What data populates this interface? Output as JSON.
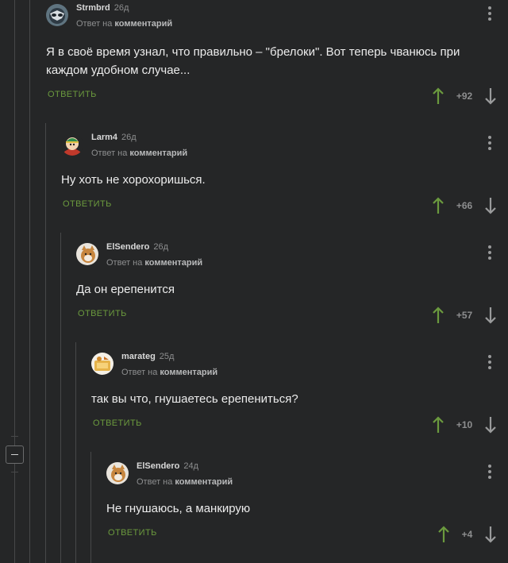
{
  "reply_to_prefix": "Ответ на",
  "reply_to_target": "комментарий",
  "reply_label": "ответить",
  "colors": {
    "upvote": "#6b9a3e",
    "downvote": "#9a9b9c",
    "reply": "#6b9a3e",
    "background": "#252627"
  },
  "comments": [
    {
      "author": "Strmbrd",
      "age": "26д",
      "text": "Я в своё время узнал, что правильно – \"брелоки\". Вот теперь чванюсь при каждом удобном случае...",
      "score": "+92",
      "avatar_icon": "raccoon-avatar-icon"
    },
    {
      "author": "Larm4",
      "age": "26д",
      "text": "Ну хоть не хорохоришься.",
      "score": "+66",
      "avatar_icon": "cartoon-avatar-icon"
    },
    {
      "author": "ElSendero",
      "age": "26д",
      "text": "Да он ерепенится",
      "score": "+57",
      "avatar_icon": "cat-avatar-icon"
    },
    {
      "author": "marateg",
      "age": "25д",
      "text": "так вы что, гнушаетесь ерепениться?",
      "score": "+10",
      "avatar_icon": "photo-avatar-icon"
    },
    {
      "author": "ElSendero",
      "age": "24д",
      "text": "Не гнушаюсь, а манкирую",
      "score": "+4",
      "avatar_icon": "cat-avatar-icon"
    }
  ]
}
